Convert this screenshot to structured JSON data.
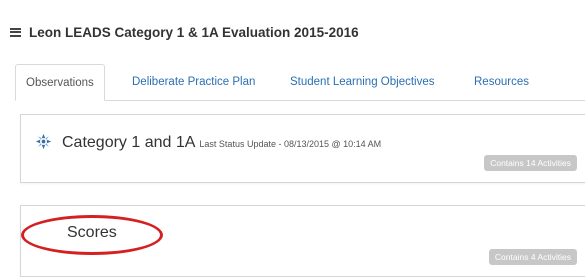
{
  "header": {
    "title": "Leon LEADS Category 1 & 1A Evaluation 2015-2016"
  },
  "tabs": [
    {
      "label": "Observations",
      "active": true
    },
    {
      "label": "Deliberate Practice Plan",
      "active": false
    },
    {
      "label": "Student Learning Objectives",
      "active": false
    },
    {
      "label": "Resources",
      "active": false
    }
  ],
  "cards": [
    {
      "title": "Category 1 and 1A",
      "status": "Last Status Update - 08/13/2015 @ 10:14 AM",
      "badge": "Contains 14 Activities",
      "icon": "activity-wheel-icon"
    },
    {
      "title": "Scores",
      "badge": "Contains 4 Activities"
    }
  ],
  "colors": {
    "link": "#2a6fb4",
    "badge_bg": "#c7c7c7",
    "highlight": "#d42020"
  }
}
